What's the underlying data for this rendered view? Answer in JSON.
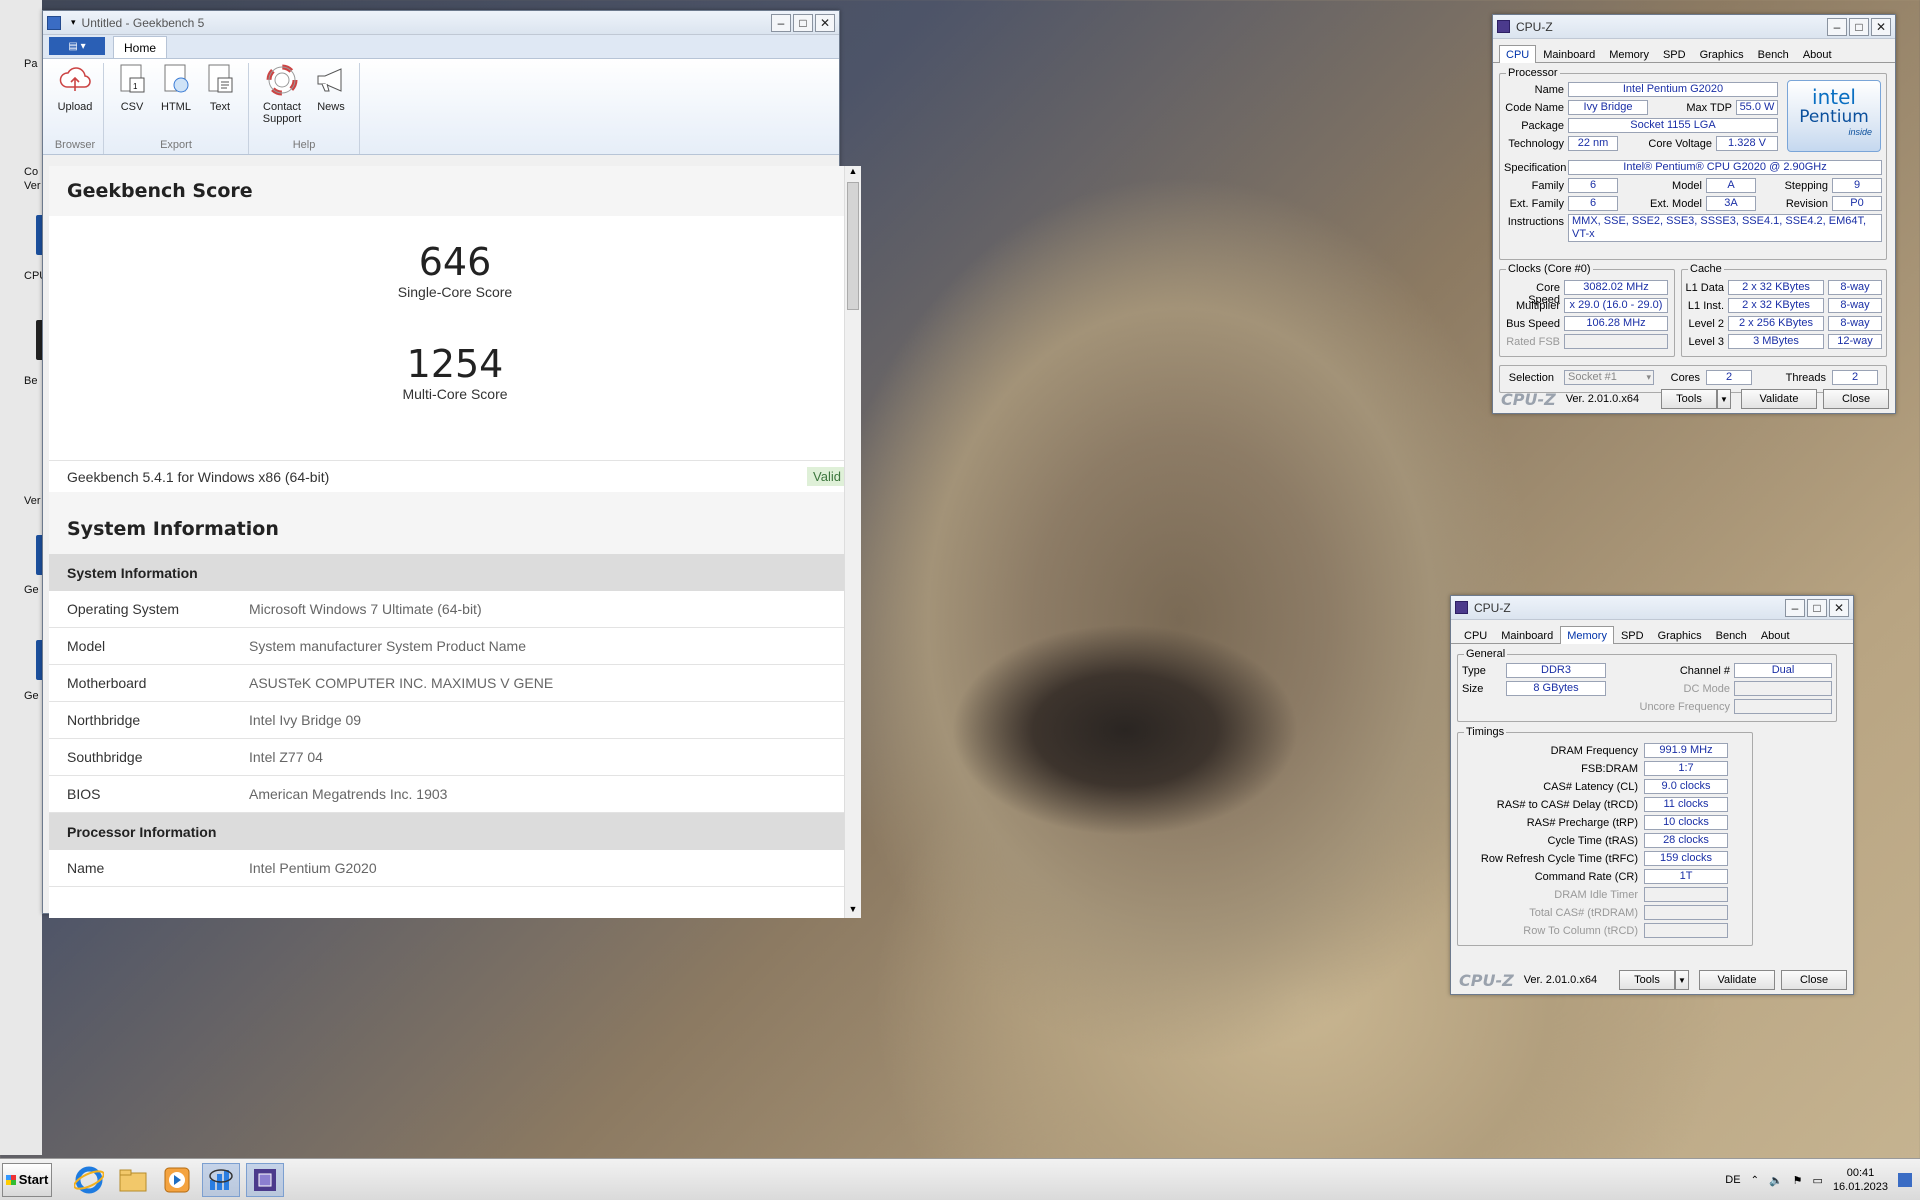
{
  "desktop": {
    "labels": [
      "Pa",
      "Co",
      "Ver",
      "CPU",
      "Be",
      "Ver",
      "Ge",
      "Ge"
    ]
  },
  "geekbench": {
    "title": "Untitled - Geekbench 5",
    "tab_home": "Home",
    "ribbon": {
      "groups": [
        {
          "label": "Browser",
          "items": [
            {
              "label": "Upload",
              "icon": "upload-icon"
            }
          ]
        },
        {
          "label": "Export",
          "items": [
            {
              "label": "CSV",
              "icon": "csv-icon"
            },
            {
              "label": "HTML",
              "icon": "html-icon"
            },
            {
              "label": "Text",
              "icon": "text-icon"
            }
          ]
        },
        {
          "label": "Help",
          "items": [
            {
              "label": "Contact Support",
              "icon": "lifebuoy-icon"
            },
            {
              "label": "News",
              "icon": "megaphone-icon"
            }
          ]
        }
      ]
    },
    "score_heading": "Geekbench Score",
    "single_score": "646",
    "single_label": "Single-Core Score",
    "multi_score": "1254",
    "multi_label": "Multi-Core Score",
    "version_line": "Geekbench 5.4.1 for Windows x86 (64-bit)",
    "valid_badge": "Valid",
    "sysinfo_heading": "System Information",
    "sysinfo_group": "System Information",
    "sysinfo_rows": [
      {
        "k": "Operating System",
        "v": "Microsoft Windows 7 Ultimate (64-bit)"
      },
      {
        "k": "Model",
        "v": "System manufacturer System Product Name"
      },
      {
        "k": "Motherboard",
        "v": "ASUSTeK COMPUTER INC. MAXIMUS V GENE"
      },
      {
        "k": "Northbridge",
        "v": "Intel Ivy Bridge 09"
      },
      {
        "k": "Southbridge",
        "v": "Intel Z77 04"
      },
      {
        "k": "BIOS",
        "v": "American Megatrends Inc. 1903"
      }
    ],
    "proc_group": "Processor Information",
    "proc_rows": [
      {
        "k": "Name",
        "v": "Intel Pentium G2020"
      }
    ]
  },
  "cpuz1": {
    "title": "CPU-Z",
    "tabs": [
      "CPU",
      "Mainboard",
      "Memory",
      "SPD",
      "Graphics",
      "Bench",
      "About"
    ],
    "processor_legend": "Processor",
    "name_lbl": "Name",
    "name": "Intel Pentium G2020",
    "codename_lbl": "Code Name",
    "codename": "Ivy Bridge",
    "maxtdp_lbl": "Max TDP",
    "maxtdp": "55.0 W",
    "package_lbl": "Package",
    "package": "Socket 1155 LGA",
    "tech_lbl": "Technology",
    "tech": "22 nm",
    "cvolt_lbl": "Core Voltage",
    "cvolt": "1.328 V",
    "spec_lbl": "Specification",
    "spec": "Intel® Pentium® CPU G2020 @ 2.90GHz",
    "family_lbl": "Family",
    "family": "6",
    "model_lbl": "Model",
    "model": "A",
    "stepping_lbl": "Stepping",
    "stepping": "9",
    "extfam_lbl": "Ext. Family",
    "extfam": "6",
    "extmod_lbl": "Ext. Model",
    "extmod": "3A",
    "rev_lbl": "Revision",
    "rev": "P0",
    "instr_lbl": "Instructions",
    "instr": "MMX, SSE, SSE2, SSE3, SSSE3, SSE4.1, SSE4.2, EM64T, VT-x",
    "logo_brand": "intel",
    "logo_product": "Pentium",
    "logo_inside": "inside",
    "clocks_legend": "Clocks (Core #0)",
    "corespeed_lbl": "Core Speed",
    "corespeed": "3082.02 MHz",
    "mult_lbl": "Multiplier",
    "mult": "x 29.0 (16.0 - 29.0)",
    "bus_lbl": "Bus Speed",
    "bus": "106.28 MHz",
    "fsb_lbl": "Rated FSB",
    "cache_legend": "Cache",
    "l1d_lbl": "L1 Data",
    "l1d": "2 x 32 KBytes",
    "l1d_w": "8-way",
    "l1i_lbl": "L1 Inst.",
    "l1i": "2 x 32 KBytes",
    "l1i_w": "8-way",
    "l2_lbl": "Level 2",
    "l2": "2 x 256 KBytes",
    "l2_w": "8-way",
    "l3_lbl": "Level 3",
    "l3": "3 MBytes",
    "l3_w": "12-way",
    "sel_lbl": "Selection",
    "sel": "Socket #1",
    "cores_lbl": "Cores",
    "cores": "2",
    "threads_lbl": "Threads",
    "threads": "2",
    "logo": "CPU-Z",
    "ver": "Ver. 2.01.0.x64",
    "tools": "Tools",
    "validate": "Validate",
    "close": "Close"
  },
  "cpuz2": {
    "title": "CPU-Z",
    "tabs": [
      "CPU",
      "Mainboard",
      "Memory",
      "SPD",
      "Graphics",
      "Bench",
      "About"
    ],
    "general_legend": "General",
    "type_lbl": "Type",
    "type": "DDR3",
    "size_lbl": "Size",
    "size": "8 GBytes",
    "channel_lbl": "Channel #",
    "channel": "Dual",
    "dcmode_lbl": "DC Mode",
    "uncore_lbl": "Uncore Frequency",
    "timings_legend": "Timings",
    "timings": [
      {
        "k": "DRAM Frequency",
        "v": "991.9 MHz"
      },
      {
        "k": "FSB:DRAM",
        "v": "1:7"
      },
      {
        "k": "CAS# Latency (CL)",
        "v": "9.0 clocks"
      },
      {
        "k": "RAS# to CAS# Delay (tRCD)",
        "v": "11 clocks"
      },
      {
        "k": "RAS# Precharge (tRP)",
        "v": "10 clocks"
      },
      {
        "k": "Cycle Time (tRAS)",
        "v": "28 clocks"
      },
      {
        "k": "Row Refresh Cycle Time (tRFC)",
        "v": "159 clocks"
      },
      {
        "k": "Command Rate (CR)",
        "v": "1T"
      },
      {
        "k": "DRAM Idle Timer",
        "v": ""
      },
      {
        "k": "Total CAS# (tRDRAM)",
        "v": ""
      },
      {
        "k": "Row To Column (tRCD)",
        "v": ""
      }
    ],
    "logo": "CPU-Z",
    "ver": "Ver. 2.01.0.x64",
    "tools": "Tools",
    "validate": "Validate",
    "close": "Close"
  },
  "taskbar": {
    "start": "Start",
    "lang": "DE",
    "time": "00:41",
    "date": "16.01.2023"
  }
}
